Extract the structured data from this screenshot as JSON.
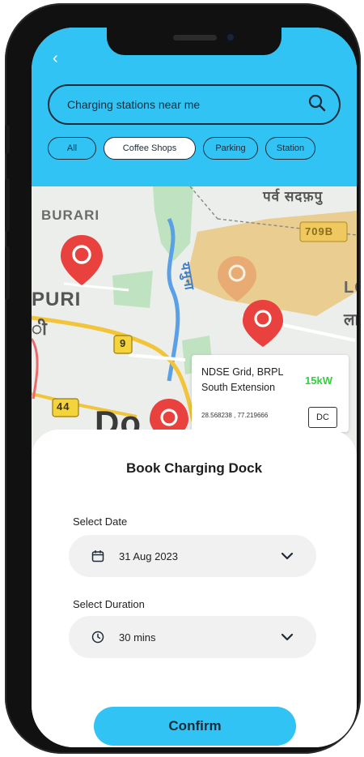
{
  "header": {
    "search": {
      "text": "Charging stations near me"
    },
    "chips": [
      {
        "label": "All",
        "selected": false
      },
      {
        "label": "Coffee Shops",
        "selected": true
      },
      {
        "label": "Parking",
        "selected": false
      },
      {
        "label": "Station",
        "selected": false
      }
    ]
  },
  "map": {
    "labels": {
      "burari": "BURARI",
      "puri": "PURI",
      "road_9": "9",
      "road_44": "44",
      "road_709b": "709B",
      "big": "Do",
      "hindi_river": "यमुना",
      "hindi_ri": "ी",
      "hindi_top": "पर्व सदफ़पु",
      "hindi_la": "ला",
      "lo": "LO"
    },
    "station_card": {
      "name_line1": "NDSE Grid, BRPL",
      "name_line2": "South Extension",
      "power": "15kW",
      "coords": "28.568238 , 77.219666",
      "type": "DC"
    },
    "colors": {
      "pin": "#e8413e",
      "highlight": "#e9c26e",
      "road": "#f2c43a"
    }
  },
  "booking": {
    "title": "Book Charging Dock",
    "date_label": "Select Date",
    "date_value": "31 Aug 2023",
    "duration_label": "Select Duration",
    "duration_value": "30 mins",
    "confirm_label": "Confirm"
  },
  "colors": {
    "accent": "#31c3f3",
    "dark": "#1d2b3a",
    "green": "#2ed23a"
  }
}
